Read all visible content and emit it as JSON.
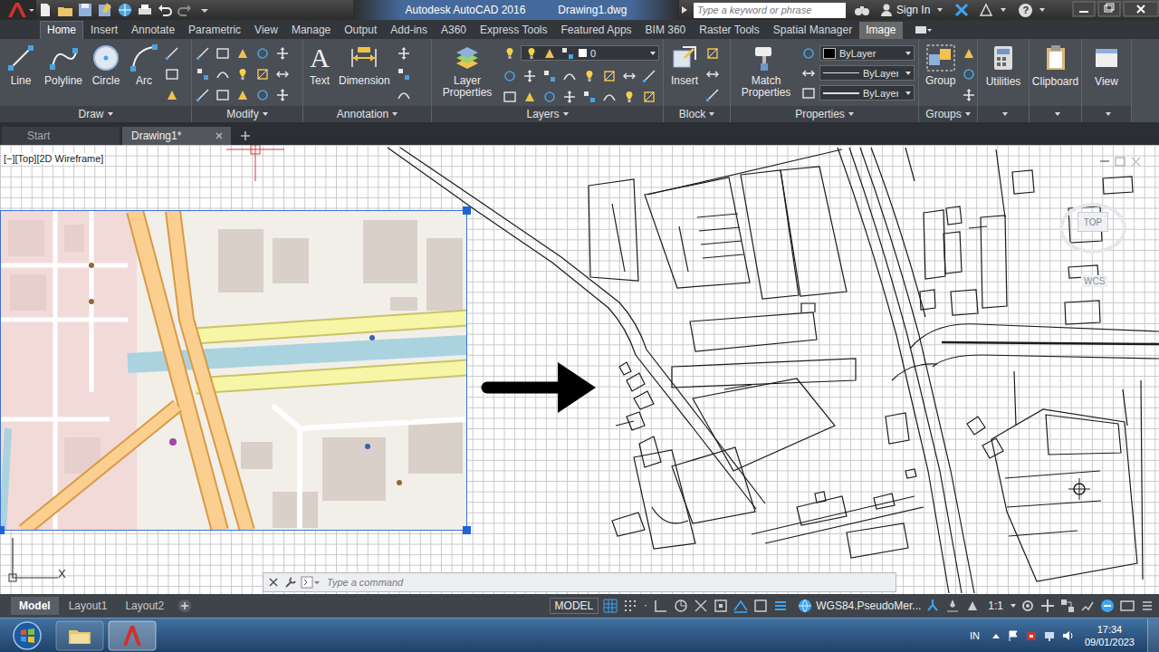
{
  "title_bar": {
    "app": "Autodesk AutoCAD 2016",
    "document": "Drawing1.dwg",
    "search_placeholder": "Type a keyword or phrase",
    "sign_in": "Sign In",
    "help": "?"
  },
  "ribbon_tabs": [
    {
      "label": "Home",
      "selected": true,
      "kind": "normal"
    },
    {
      "label": "Insert",
      "selected": false,
      "kind": "normal"
    },
    {
      "label": "Annotate",
      "selected": false,
      "kind": "normal"
    },
    {
      "label": "Parametric",
      "selected": false,
      "kind": "normal"
    },
    {
      "label": "View",
      "selected": false,
      "kind": "normal"
    },
    {
      "label": "Manage",
      "selected": false,
      "kind": "normal"
    },
    {
      "label": "Output",
      "selected": false,
      "kind": "normal"
    },
    {
      "label": "Add-ins",
      "selected": false,
      "kind": "normal"
    },
    {
      "label": "A360",
      "selected": false,
      "kind": "normal"
    },
    {
      "label": "Express Tools",
      "selected": false,
      "kind": "normal"
    },
    {
      "label": "Featured Apps",
      "selected": false,
      "kind": "normal"
    },
    {
      "label": "BIM 360",
      "selected": false,
      "kind": "normal"
    },
    {
      "label": "Raster Tools",
      "selected": false,
      "kind": "normal"
    },
    {
      "label": "Spatial Manager",
      "selected": false,
      "kind": "normal"
    },
    {
      "label": "Image",
      "selected": false,
      "kind": "contextual"
    }
  ],
  "ribbon_panels": [
    {
      "title": "Draw",
      "tools": [
        "Line",
        "Polyline",
        "Circle",
        "Arc"
      ]
    },
    {
      "title": "Modify",
      "tools": []
    },
    {
      "title": "Annotation",
      "tools": [
        "Text",
        "Dimension"
      ],
      "text_icon": "A"
    },
    {
      "title": "Layers",
      "tools": [
        "Layer Properties"
      ],
      "layer": "0"
    },
    {
      "title": "Block",
      "tools": [
        "Insert"
      ]
    },
    {
      "title": "Properties",
      "tools": [
        "Match Properties"
      ],
      "color": "ByLayer",
      "linetype": "ByLayer",
      "lineweight": "ByLayer"
    },
    {
      "title": "Groups",
      "tools": [
        "Group"
      ]
    }
  ],
  "collapsed_panels": [
    "Utilities",
    "Clipboard",
    "View"
  ],
  "file_tabs": [
    {
      "label": "Start",
      "selected": false
    },
    {
      "label": "Drawing1*",
      "selected": true
    }
  ],
  "viewport": {
    "label": "[−][Top][2D Wireframe]",
    "viewcube_face": "TOP",
    "ucs_name": "WCS",
    "ucs_axis": "X"
  },
  "image": {
    "selected": true
  },
  "command_line": {
    "placeholder": "Type a command"
  },
  "layout_tabs": [
    {
      "label": "Model",
      "selected": true
    },
    {
      "label": "Layout1",
      "selected": false
    },
    {
      "label": "Layout2",
      "selected": false
    }
  ],
  "status_bar": {
    "space": "MODEL",
    "coordinate_system": "WGS84.PseudoMer...",
    "scale": "1:1"
  },
  "taskbar": {
    "language": "IN",
    "time": "17:34",
    "date": "09/01/2023"
  }
}
